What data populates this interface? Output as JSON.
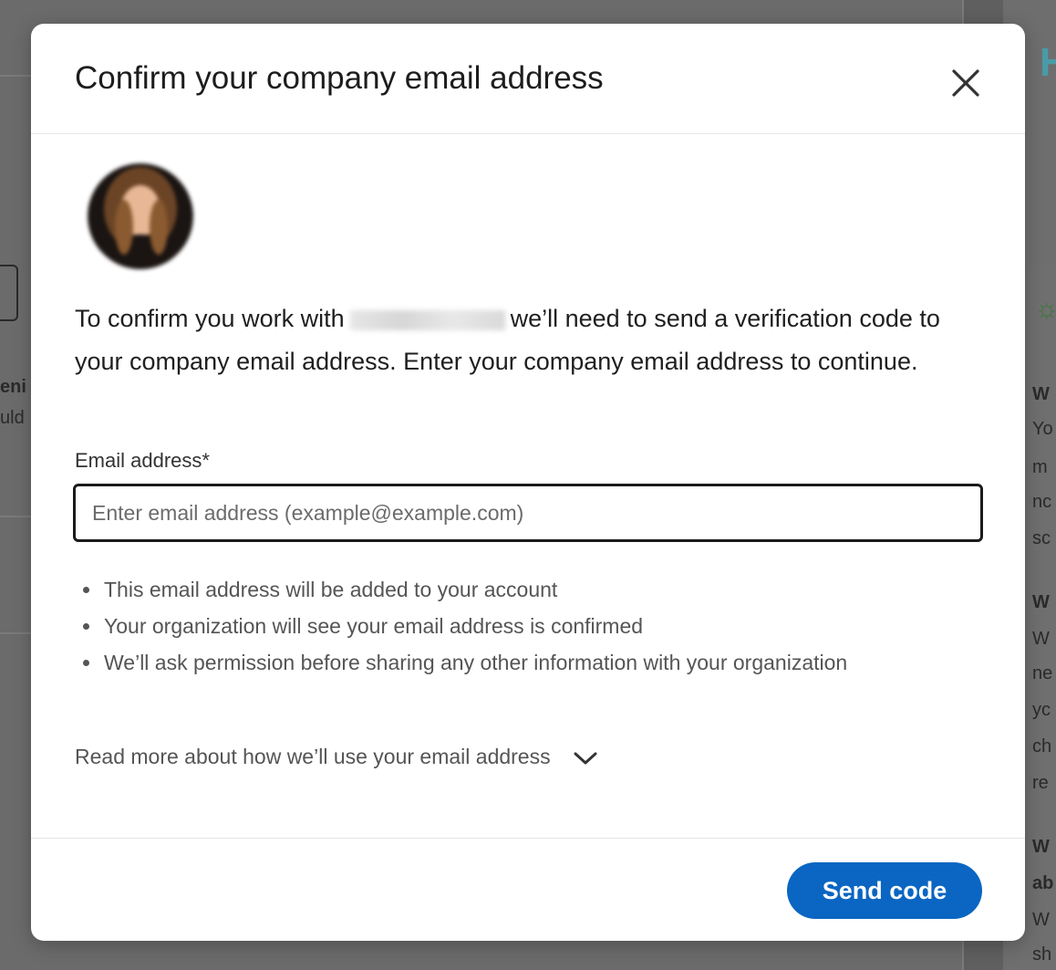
{
  "background": {
    "fragments_left": [
      "eni",
      "uld"
    ],
    "fragments_right": [
      "W",
      "Yo",
      "m",
      "nc",
      "sc",
      "W",
      "W",
      "ne",
      "yc",
      "ch",
      "re",
      "W",
      "ab",
      "W",
      "sh"
    ],
    "header_icon": "H"
  },
  "modal": {
    "title": "Confirm your company email address",
    "close_icon": "close-icon",
    "intro_before": "To confirm you work with",
    "intro_after": "we’ll need to send a verification code to your company email address. Enter your company email address to continue.",
    "email": {
      "label": "Email address*",
      "placeholder": "Enter email address (example@example.com)",
      "value": ""
    },
    "info_items": [
      "This email address will be added to your account",
      "Your organization will see your email address is confirmed",
      "We’ll ask permission before sharing any other information with your organization"
    ],
    "read_more": "Read more about how we’ll use your email address",
    "send_button": "Send code"
  },
  "colors": {
    "primary": "#0a66c2",
    "overlay": "#6b6b6b",
    "text": "#1f1f1f",
    "muted": "#555555"
  }
}
